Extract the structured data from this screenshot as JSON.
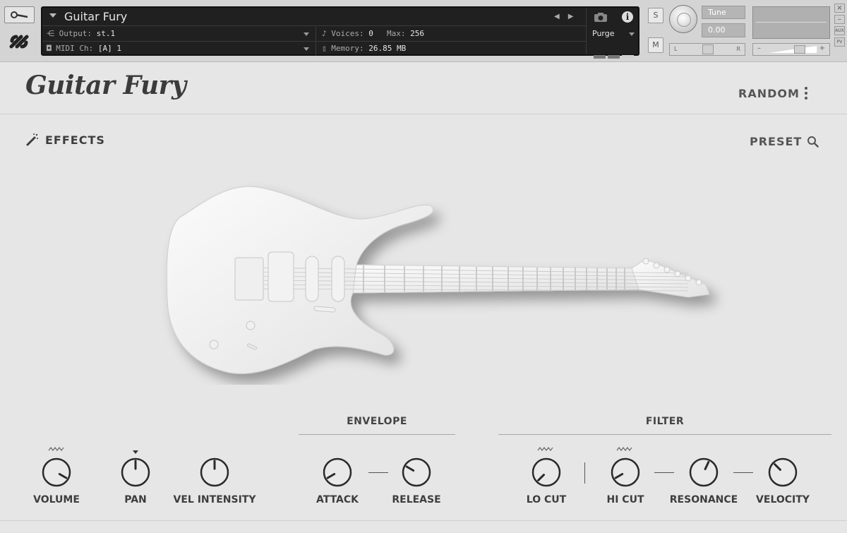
{
  "kontakt": {
    "instrument_name": "Guitar Fury",
    "output_label": "Output:",
    "output_value": "st.1",
    "midi_label": "MIDI Ch:",
    "midi_value": "[A]  1",
    "voices_label": "Voices:",
    "voices_value": "0",
    "max_label": "Max:",
    "max_value": "256",
    "memory_label": "Memory:",
    "memory_value": "26.85 MB",
    "purge_label": "Purge",
    "solo_label": "S",
    "mute_label": "M",
    "tune_label": "Tune",
    "tune_value": "0.00",
    "pan_left": "L",
    "pan_right": "R",
    "vol_minus": "–",
    "vol_plus": "+",
    "aux_label": "AUX",
    "pv_label": "PV",
    "close_label": "×",
    "min_label": "–"
  },
  "instrument": {
    "title": "Guitar Fury",
    "random_label": "RANDOM",
    "effects_label": "EFFECTS",
    "preset_label": "PRESET"
  },
  "sections": {
    "envelope": "ENVELOPE",
    "filter": "FILTER"
  },
  "knobs": [
    {
      "id": "volume",
      "label": "VOLUME",
      "angle": 120
    },
    {
      "id": "pan",
      "label": "PAN",
      "angle": 0
    },
    {
      "id": "vel_intensity",
      "label": "VEL INTENSITY",
      "angle": 0
    },
    {
      "id": "attack",
      "label": "ATTACK",
      "angle": -120
    },
    {
      "id": "release",
      "label": "RELEASE",
      "angle": -60
    },
    {
      "id": "lo_cut",
      "label": "LO CUT",
      "angle": -135
    },
    {
      "id": "hi_cut",
      "label": "HI CUT",
      "angle": -120
    },
    {
      "id": "resonance",
      "label": "RESONANCE",
      "angle": 25
    },
    {
      "id": "velocity",
      "label": "VELOCITY",
      "angle": -45
    }
  ]
}
